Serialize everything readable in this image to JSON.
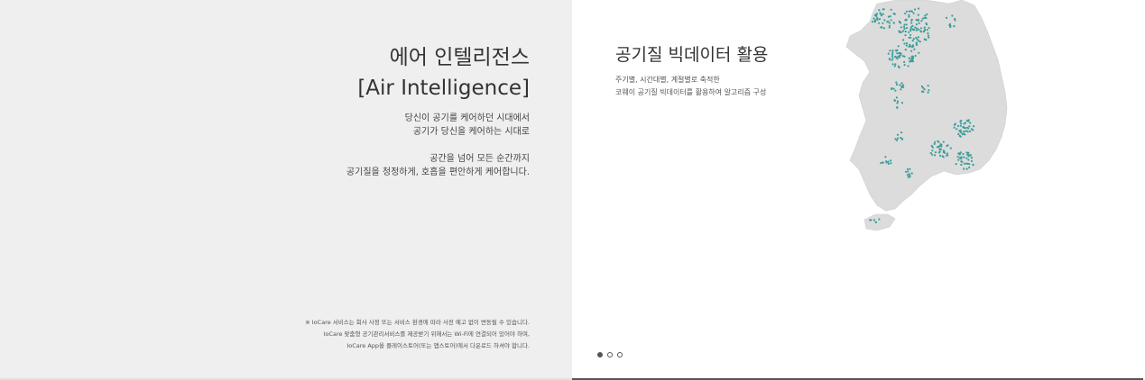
{
  "left": {
    "heading_kr": "에어 인텔리전스",
    "heading_en": "[Air Intelligence]",
    "desc1_line1": "당신이 공기를 케어하던 시대에서",
    "desc1_line2": "공기가 당신을 케어하는 시대로",
    "desc2_line1": "공간을 넘어 모든 순간까지",
    "desc2_line2": "공기질을 청정하게, 호흡을 편안하게 케어합니다.",
    "notice_line1": "※ IoCare 서비스는 회사 사정 또는 서비스 환경에 따라 사전 예고 없이 변동될 수 있습니다.",
    "notice_line2": "IoCare 맞춤형 공기관리서비스를 제공받기 위해서는 Wi-Fi에 연결되어 있어야 하며,",
    "notice_line3": "IoCare App을 플레이스토어(또는 앱스토어)에서 다운로드 하셔야 합니다."
  },
  "right": {
    "title": "공기질 빅데이터 활용",
    "sub_line1": "주기별, 시간대별, 계절별로 축적한",
    "sub_line2": "코웨이 공기질 빅데이터를 활용하여 알고리즘 구성",
    "map_icon": "korea-map-icon",
    "map_color": "#d9d9d9",
    "marker_color": "#3a9e9a"
  },
  "pagination": {
    "count": 3,
    "active_index": 0
  }
}
